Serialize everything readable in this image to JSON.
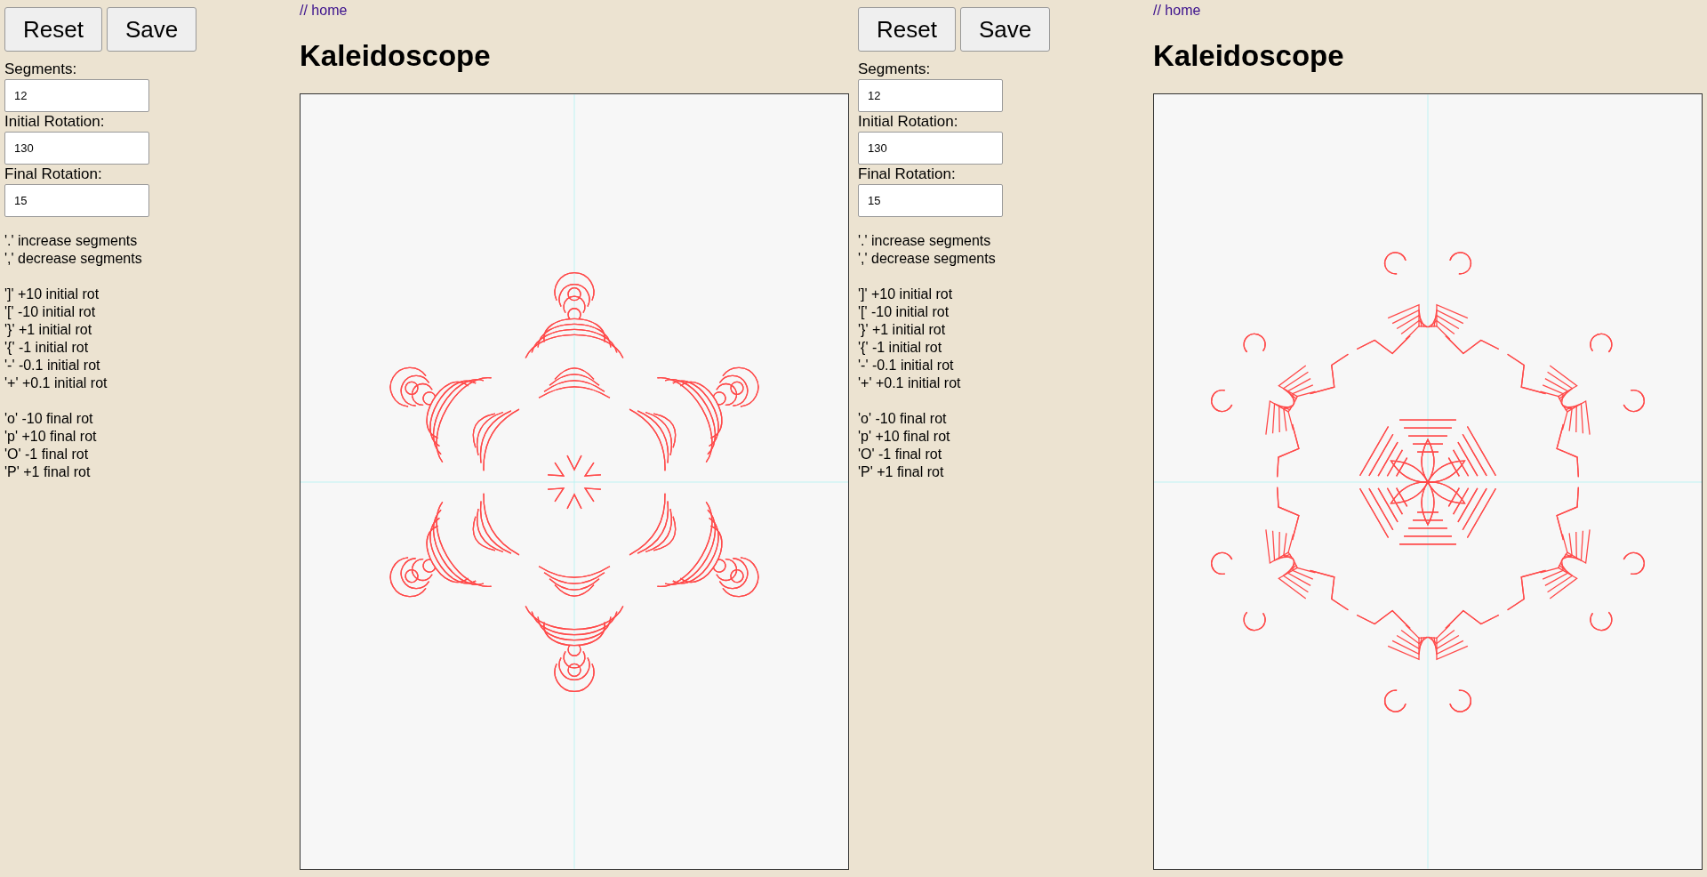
{
  "panes": [
    {
      "buttons": [
        "Reset",
        "Save"
      ],
      "fields": [
        {
          "label": "Segments:",
          "value": "12"
        },
        {
          "label": "Initial Rotation:",
          "value": "130"
        },
        {
          "label": "Final Rotation:",
          "value": "15"
        }
      ],
      "help": [
        [
          "'.' increase segments",
          "',' decrease segments"
        ],
        [
          "']' +10 initial rot",
          "'[' -10 initial rot",
          "'}' +1 initial rot",
          "'{' -1 initial rot",
          "'-' -0.1 initial rot",
          "'+' +0.1 initial rot"
        ],
        [
          "'o' -10 final rot",
          "'p' +10 final rot",
          "'O' -1 final rot",
          "'P' +1 final rot"
        ]
      ],
      "link": "// home",
      "title": "Kaleidoscope",
      "kind": "star"
    },
    {
      "buttons": [
        "Reset",
        "Save"
      ],
      "fields": [
        {
          "label": "Segments:",
          "value": "12"
        },
        {
          "label": "Initial Rotation:",
          "value": "130"
        },
        {
          "label": "Final Rotation:",
          "value": "15"
        }
      ],
      "help": [
        [
          "'.' increase segments",
          "',' decrease segments"
        ],
        [
          "']' +10 initial rot",
          "'[' -10 initial rot",
          "'}' +1 initial rot",
          "'{' -1 initial rot",
          "'-' -0.1 initial rot",
          "'+' +0.1 initial rot"
        ],
        [
          "'o' -10 final rot",
          "'p' +10 final rot",
          "'O' -1 final rot",
          "'P' +1 final rot"
        ]
      ],
      "link": "// home",
      "title": "Kaleidoscope",
      "kind": "flower"
    }
  ]
}
